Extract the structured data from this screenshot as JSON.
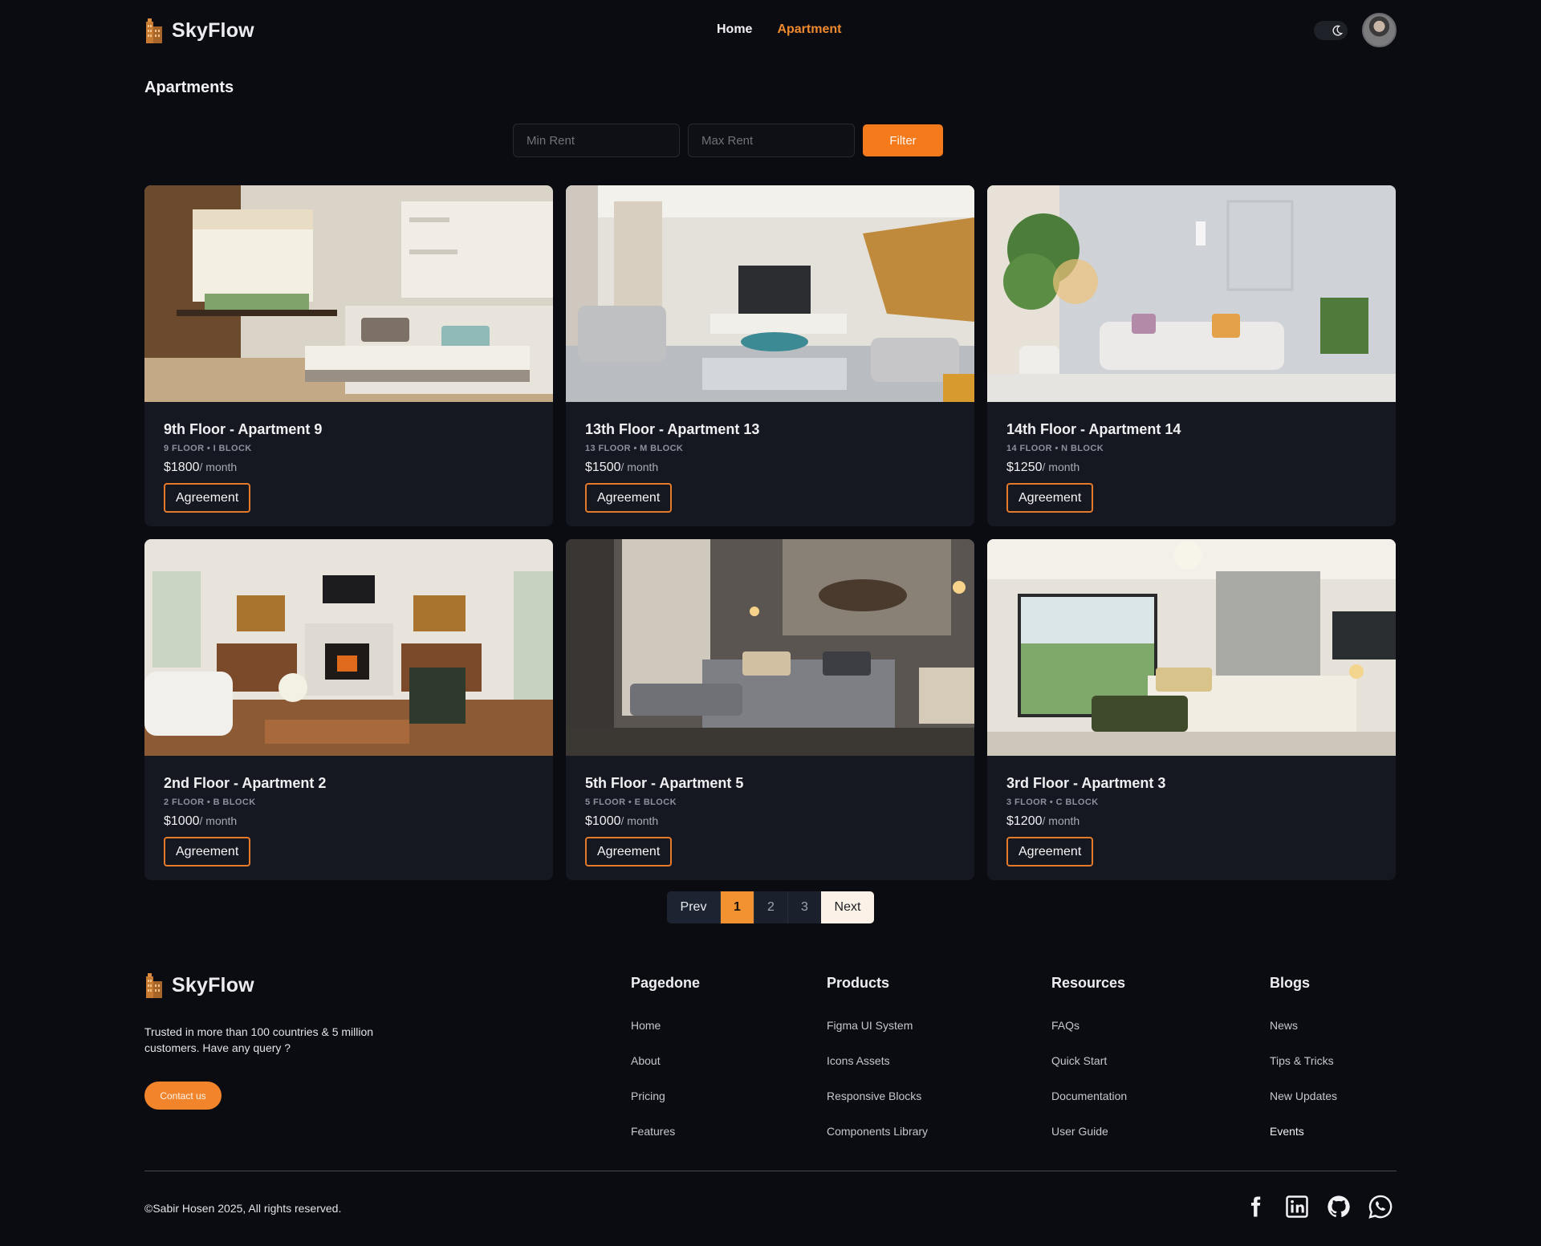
{
  "header": {
    "brand": "SkyFlow",
    "nav": [
      {
        "label": "Home",
        "active": false
      },
      {
        "label": "Apartment",
        "active": true
      }
    ],
    "theme_toggle_icon": "moon-icon"
  },
  "page": {
    "title": "Apartments"
  },
  "filter": {
    "min_placeholder": "Min Rent",
    "max_placeholder": "Max Rent",
    "button_label": "Filter"
  },
  "apartments": [
    {
      "title": "9th Floor - Apartment 9",
      "meta": "9 FLOOR • I BLOCK",
      "price": "$1800",
      "per": "/ month",
      "button": "Agreement"
    },
    {
      "title": "13th Floor - Apartment 13",
      "meta": "13 FLOOR • M BLOCK",
      "price": "$1500",
      "per": "/ month",
      "button": "Agreement"
    },
    {
      "title": "14th Floor - Apartment 14",
      "meta": "14 FLOOR • N BLOCK",
      "price": "$1250",
      "per": "/ month",
      "button": "Agreement"
    },
    {
      "title": "2nd Floor - Apartment 2",
      "meta": "2 FLOOR • B BLOCK",
      "price": "$1000",
      "per": "/ month",
      "button": "Agreement"
    },
    {
      "title": "5th Floor - Apartment 5",
      "meta": "5 FLOOR • E BLOCK",
      "price": "$1000",
      "per": "/ month",
      "button": "Agreement"
    },
    {
      "title": "3rd Floor - Apartment 3",
      "meta": "3 FLOOR • C BLOCK",
      "price": "$1200",
      "per": "/ month",
      "button": "Agreement"
    }
  ],
  "pagination": {
    "prev": "Prev",
    "pages": [
      "1",
      "2",
      "3"
    ],
    "current": "1",
    "next": "Next"
  },
  "footer": {
    "brand": "SkyFlow",
    "tagline": "Trusted in more than 100 countries & 5 million customers. Have any query ?",
    "contact_button": "Contact us",
    "columns": [
      {
        "heading": "Pagedone",
        "links": [
          "Home",
          "About",
          "Pricing",
          "Features"
        ]
      },
      {
        "heading": "Products",
        "links": [
          "Figma UI System",
          "Icons Assets",
          "Responsive Blocks",
          "Components Library"
        ]
      },
      {
        "heading": "Resources",
        "links": [
          "FAQs",
          "Quick Start",
          "Documentation",
          "User Guide"
        ]
      },
      {
        "heading": "Blogs",
        "links": [
          "News",
          "Tips & Tricks",
          "New Updates",
          "Events"
        ]
      }
    ],
    "copyright": "©Sabir Hosen 2025, All rights reserved.",
    "socials": [
      "facebook-icon",
      "linkedin-icon",
      "github-icon",
      "whatsapp-icon"
    ]
  },
  "colors": {
    "background": "#0b0c12",
    "card": "#151821",
    "accent": "#f57a1c",
    "nav_active": "#f08a2e"
  }
}
